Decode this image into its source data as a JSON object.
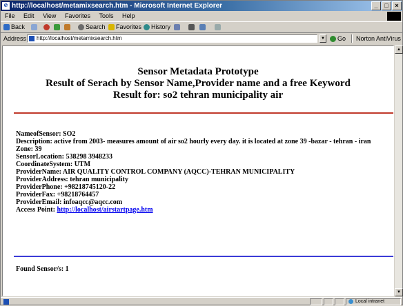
{
  "window": {
    "title": "http://localhost/metamixsearch.htm - Microsoft Internet Explorer",
    "buttons": {
      "minimize": "_",
      "maximize": "□",
      "close": "×"
    }
  },
  "menu": {
    "items": [
      "File",
      "Edit",
      "View",
      "Favorites",
      "Tools",
      "Help"
    ]
  },
  "toolbar": {
    "back": "Back",
    "search": "Search",
    "favorites": "Favorites",
    "history": "History"
  },
  "address": {
    "label": "Address",
    "url": "http://localhost/metamixsearch.htm",
    "go": "Go",
    "norton": "Norton AntiVirus"
  },
  "page": {
    "title_line1": "Sensor Metadata Prototype",
    "title_line2": "Result of Serach by Sensor Name,Provider name and a free Keyword",
    "title_line3": "Result for: so2 tehran municipality air",
    "details": [
      "NameofSensor: SO2",
      "Description: active from 2003- measures amount of air so2 hourly every day. it is located at zone 39 -bazar - tehran - iran",
      "Zone: 39",
      "SensorLocation: 538298 3948233",
      "CoordinateSystem: UTM",
      "ProviderName: AIR QUALITY CONTROL COMPANY (AQCC)-TEHRAN MUNICIPALITY",
      "ProviderAddress: tehran municipality",
      "ProviderPhone: +98218745120-22",
      "ProviderFax: +98218764457",
      "ProviderEmail: infoaqcc@aqcc.com"
    ],
    "access_point_label": "Access Point: ",
    "access_point_link": "http://localhost/airstartpage.htm",
    "found": "Found Sensor/s: 1"
  },
  "status": {
    "zone": "Local intranet"
  },
  "colors": {
    "red_rule": "#c0392b",
    "blue_rule": "#3b3bd6",
    "link": "#0000ee"
  }
}
